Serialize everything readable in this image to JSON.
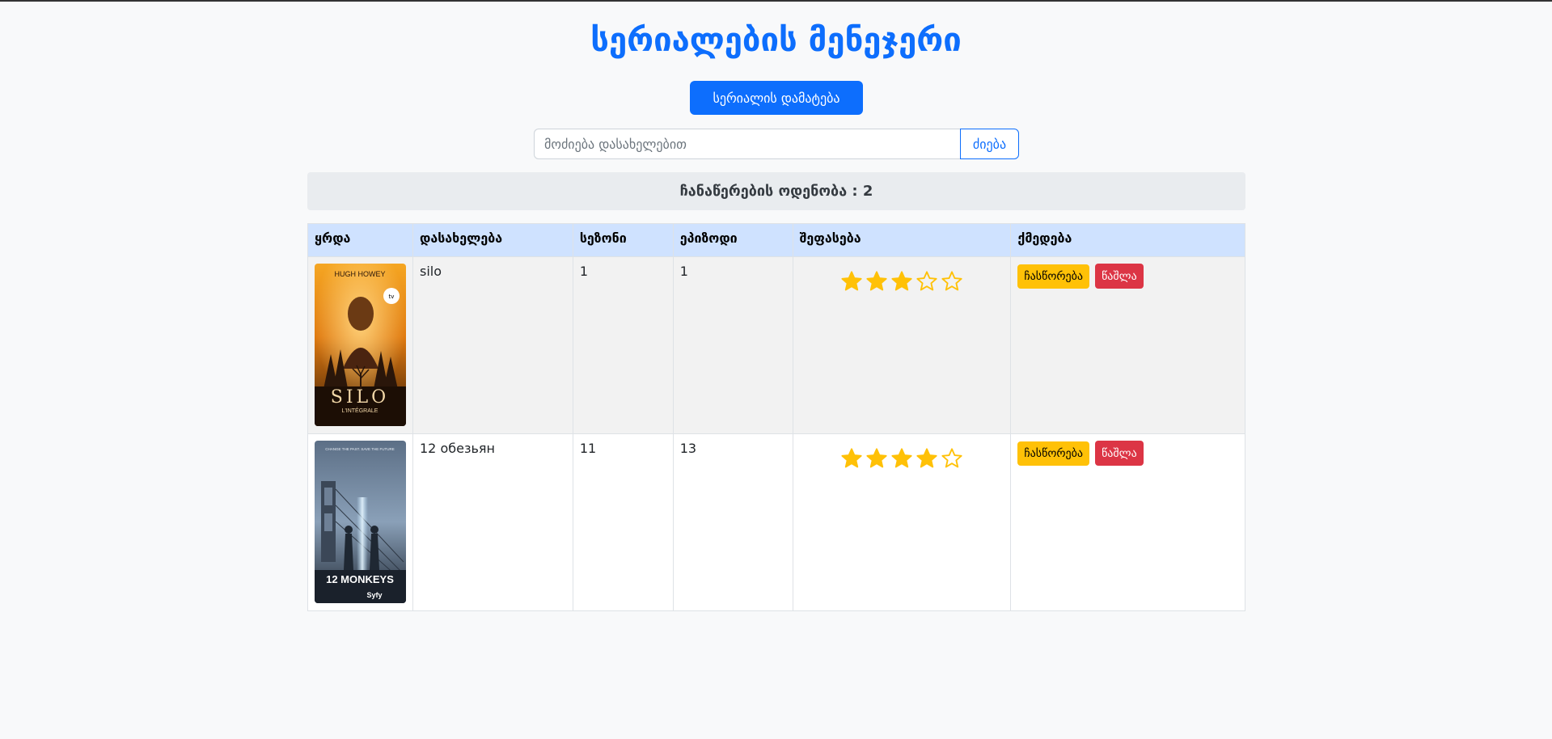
{
  "page": {
    "title": "სერიალების მენეჯერი",
    "add_button_label": "სერიალის დამატება"
  },
  "search": {
    "placeholder": "მოძიება დასახელებით",
    "value": "",
    "button_label": "ძიება"
  },
  "record_count": {
    "text": "ჩანაწერების ოდენობა : 2"
  },
  "table": {
    "headers": [
      "ყრდა",
      "დასახელება",
      "სეზონი",
      "ეპიზოდი",
      "შეფასება",
      "ქმედება"
    ],
    "rows": [
      {
        "poster": {
          "author": "HUGH HOWEY",
          "title": "SILO",
          "subtitle": "L'INTÉGRALE",
          "badge": "tv"
        },
        "name": "silo",
        "season": "1",
        "episode": "1",
        "rating": 3,
        "rating_max": 5,
        "edit_label": "ჩასწორება",
        "delete_label": "წაშლა"
      },
      {
        "poster": {
          "tagline": "CHANGE THE PAST. SAVE THE FUTURE",
          "title": "12 MONKEYS",
          "network": "Syfy"
        },
        "name": "12 обезьян",
        "season": "11",
        "episode": "13",
        "rating": 4,
        "rating_max": 5,
        "edit_label": "ჩასწორება",
        "delete_label": "წაშლა"
      }
    ]
  },
  "colors": {
    "primary": "#0d6efd",
    "warning": "#ffc107",
    "danger": "#dc3545",
    "star": "#ffc107",
    "header_bg": "#cfe2ff"
  }
}
